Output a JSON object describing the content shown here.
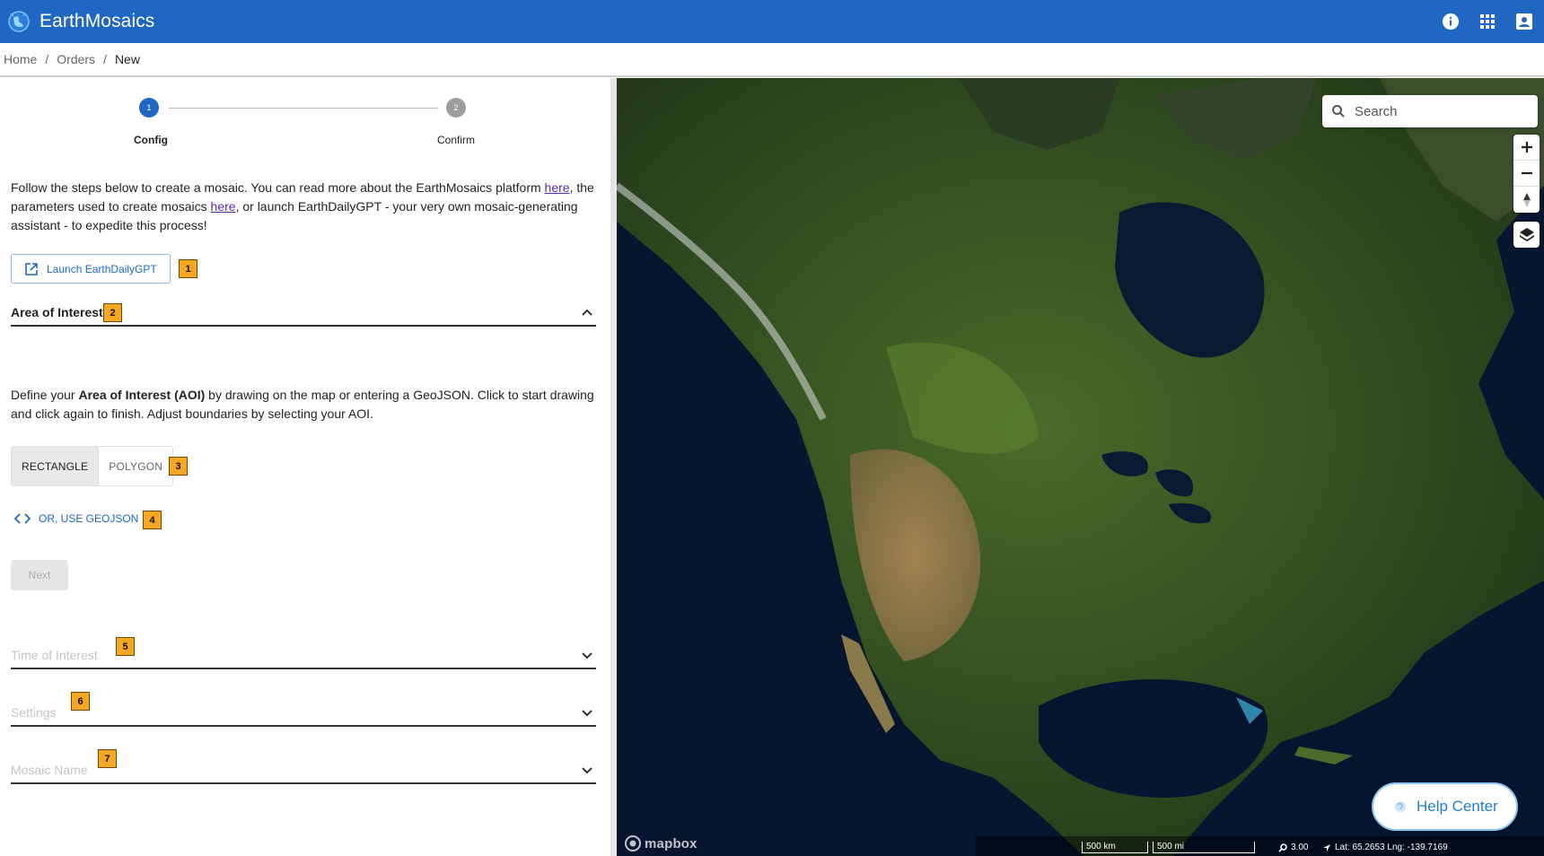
{
  "header": {
    "app_title": "EarthMosaics",
    "icons": [
      "globe-logo-icon",
      "info-icon",
      "apps-grid-icon",
      "account-icon"
    ],
    "bar_color": "#1f67c2"
  },
  "breadcrumb": {
    "items": [
      "Home",
      "Orders",
      "New"
    ],
    "separator": "/"
  },
  "stepper": {
    "steps": [
      {
        "number": "1",
        "label": "Config",
        "active": true
      },
      {
        "number": "2",
        "label": "Confirm",
        "active": false
      }
    ]
  },
  "intro": {
    "text_1": "Follow the steps below to create a mosaic. You can read more about the EarthMosaics platform ",
    "link_1": "here",
    "text_2": ", the parameters used to create mosaics ",
    "link_2": "here",
    "text_3": ", or launch EarthDailyGPT - your very own mosaic-generating assistant - to expedite this process!"
  },
  "launch_button": {
    "label": "Launch EarthDailyGPT",
    "icon": "open-in-new-icon"
  },
  "badges": [
    "1",
    "2",
    "3",
    "4",
    "5",
    "6",
    "7"
  ],
  "sections": {
    "aoi": {
      "title": "Area of Interest",
      "expanded": true
    },
    "toi": {
      "title": "Time of Interest",
      "expanded": false
    },
    "settings": {
      "title": "Settings",
      "expanded": false
    },
    "mosaic_name": {
      "title": "Mosaic Name",
      "expanded": false
    }
  },
  "aoi": {
    "desc_1": "Define your ",
    "desc_bold": "Area of Interest (AOI)",
    "desc_2": " by drawing on the map or entering a GeoJSON. Click to start drawing and click again to finish. Adjust boundaries by selecting your AOI.",
    "toggle_options": [
      "RECTANGLE",
      "POLYGON"
    ],
    "selected_toggle": "RECTANGLE",
    "geojson_label": "OR, USE GEOJSON",
    "next_label": "Next"
  },
  "map": {
    "search_placeholder": "Search",
    "help_center_label": "Help Center",
    "attribution": "mapbox",
    "scale_km": "500 km",
    "scale_mi": "500 mi",
    "zoom_level": "3.00",
    "coords": "Lat: 65.2653 Lng: -139.7169"
  }
}
